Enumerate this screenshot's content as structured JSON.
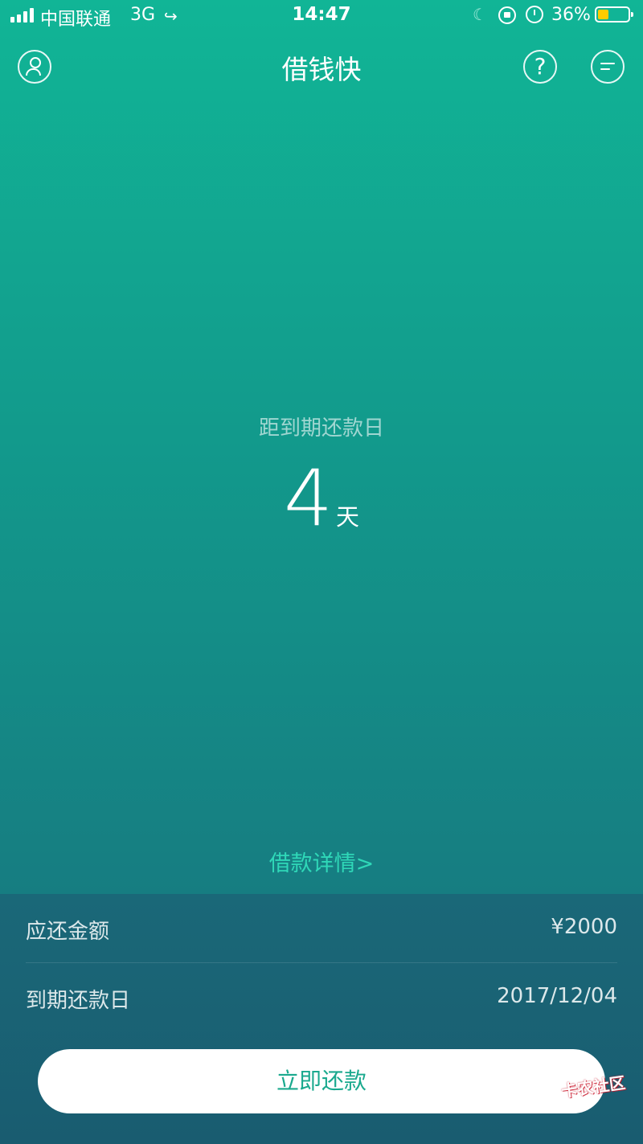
{
  "status_bar": {
    "carrier": "中国联通",
    "network": "3G",
    "time": "14:47",
    "battery_percent": "36%",
    "battery_level": 0.36,
    "battery_color": "#ffcc00"
  },
  "nav": {
    "title": "借钱快",
    "help_symbol": "?"
  },
  "countdown": {
    "label": "距到期还款日",
    "value": "4",
    "unit": "天"
  },
  "loan_details_link": "借款详情>",
  "info": {
    "amount_label": "应还金额",
    "amount_value": "¥2000",
    "due_label": "到期还款日",
    "due_value": "2017/12/04"
  },
  "repay_button": "立即还款",
  "watermark": "卡农社区",
  "colors": {
    "primary_top": "#11b596",
    "primary_bottom": "#176f7a",
    "accent_link": "#2fd8b8",
    "button_text": "#1aa98e"
  }
}
